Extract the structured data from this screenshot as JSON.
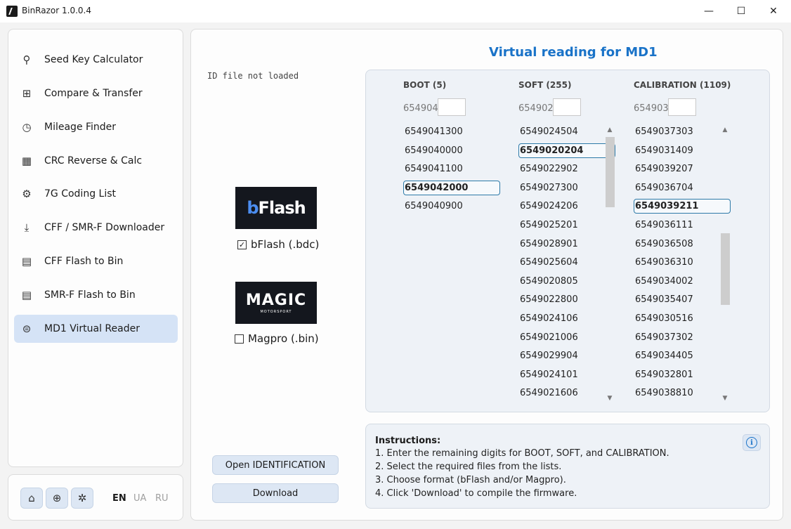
{
  "window": {
    "title": "BinRazor 1.0.0.4",
    "minimize_glyph": "—",
    "maximize_glyph": "☐",
    "close_glyph": "✕"
  },
  "sidebar": {
    "items": [
      {
        "label": "Seed Key Calculator",
        "icon": "key-icon",
        "glyph": "⚲"
      },
      {
        "label": "Compare & Transfer",
        "icon": "compare-icon",
        "glyph": "⊞"
      },
      {
        "label": "Mileage Finder",
        "icon": "clock-icon",
        "glyph": "◷"
      },
      {
        "label": "CRC Reverse & Calc",
        "icon": "calculator-icon",
        "glyph": "▦"
      },
      {
        "label": "7G Coding List",
        "icon": "gears-icon",
        "glyph": "⚙"
      },
      {
        "label": "CFF / SMR-F Downloader",
        "icon": "download-icon",
        "glyph": "⤓"
      },
      {
        "label": "CFF Flash to Bin",
        "icon": "file-chart-icon",
        "glyph": "▤"
      },
      {
        "label": "SMR-F Flash to Bin",
        "icon": "file-chart-icon",
        "glyph": "▤"
      },
      {
        "label": "MD1 Virtual Reader",
        "icon": "chip-icon",
        "glyph": "⊜"
      }
    ],
    "active_index": 8
  },
  "bottombar": {
    "home_glyph": "⌂",
    "globe_glyph": "⊕",
    "settings_glyph": "✲",
    "languages": [
      "EN",
      "UA",
      "RU"
    ],
    "selected_language": "EN"
  },
  "main": {
    "heading": "Virtual reading for MD1",
    "id_status": "ID file not loaded",
    "bflash_logo_b": "b",
    "bflash_logo_rest": "Flash",
    "magic_logo_word": "MAGIC",
    "magic_logo_sub": "MOTORSPORT",
    "bflash_label": "bFlash (.bdc)",
    "bflash_checked": true,
    "magpro_label": "Magpro (.bin)",
    "magpro_checked": false,
    "check_glyph": "✓",
    "open_button": "Open IDENTIFICATION",
    "download_button": "Download"
  },
  "columns": {
    "boot": {
      "header": "BOOT (5)",
      "prefix": "654904",
      "suffix": "",
      "items": [
        "6549041300",
        "6549040000",
        "6549041100",
        "6549042000",
        "6549040900"
      ],
      "selected": 3
    },
    "soft": {
      "header": "SOFT (255)",
      "prefix": "654902",
      "suffix": "",
      "items": [
        "6549024504",
        "6549020204",
        "6549022902",
        "6549027300",
        "6549024206",
        "6549025201",
        "6549028901",
        "6549025604",
        "6549020805",
        "6549022800",
        "6549024106",
        "6549021006",
        "6549029904",
        "6549024101",
        "6549021606"
      ],
      "selected": 1
    },
    "calibration": {
      "header": "CALIBRATION (1109)",
      "prefix": "654903",
      "suffix": "",
      "items": [
        "6549037303",
        "6549031409",
        "6549039207",
        "6549036704",
        "6549039211",
        "6549036111",
        "6549036508",
        "6549036310",
        "6549034002",
        "6549035407",
        "6549030516",
        "6549037302",
        "6549034405",
        "6549032801",
        "6549038810"
      ],
      "selected": 4
    }
  },
  "instructions": {
    "title": "Instructions:",
    "lines": [
      "1. Enter the remaining digits for BOOT, SOFT, and CALIBRATION.",
      "2. Select the required files from the lists.",
      "3. Choose format (bFlash and/or Magpro).",
      "4. Click 'Download' to compile the firmware."
    ],
    "info_glyph": "i"
  }
}
